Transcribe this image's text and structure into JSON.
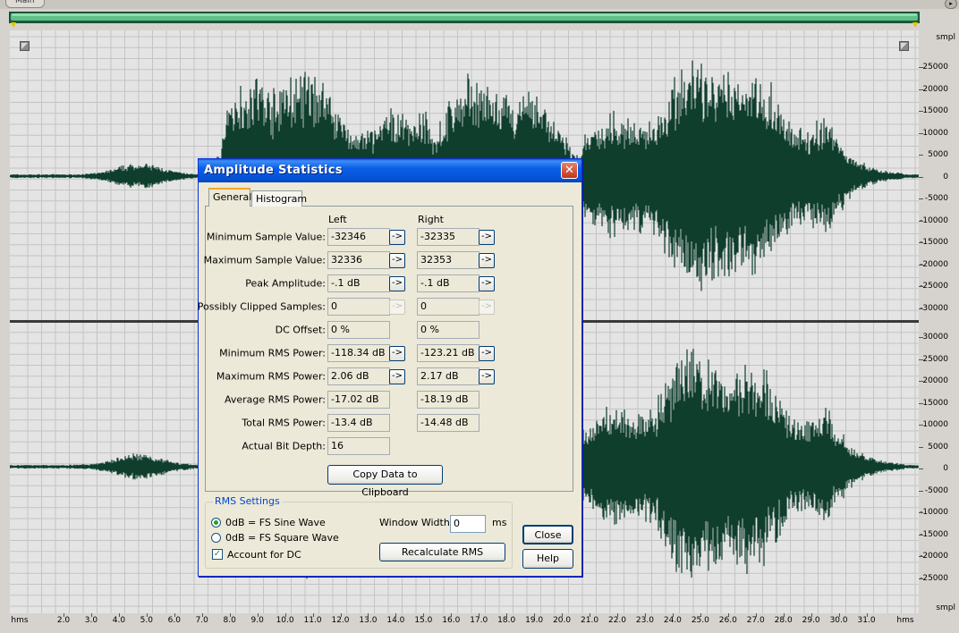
{
  "window": {
    "tab_label": "Main",
    "corner_button": "▸"
  },
  "colors": {
    "waveform": "#0f3e2d",
    "grid": "#c4c4c4",
    "background": "#e4e4e4",
    "divider": "#3a3a3a"
  },
  "vertical_ruler": {
    "unit": "smpl",
    "upper_labels": [
      "25000",
      "20000",
      "15000",
      "10000",
      "5000",
      "0",
      "-5000",
      "-10000",
      "-15000",
      "-20000",
      "-25000",
      "-30000"
    ],
    "lower_labels": [
      "30000",
      "25000",
      "20000",
      "15000",
      "10000",
      "5000",
      "0",
      "-5000",
      "-10000",
      "-15000",
      "-20000",
      "-25000"
    ]
  },
  "time_ruler": {
    "unit": "hms",
    "labels": [
      "2.0",
      "3.0",
      "4.0",
      "5.0",
      "6.0",
      "7.0",
      "8.0",
      "9.0",
      "10.0",
      "11.0",
      "12.0",
      "13.0",
      "14.0",
      "15.0",
      "16.0",
      "17.0",
      "18.0",
      "19.0",
      "20.0",
      "21.0",
      "22.0",
      "23.0",
      "24.0",
      "25.0",
      "26.0",
      "27.0",
      "28.0",
      "29.0",
      "30.0",
      "31.0"
    ]
  },
  "dialog": {
    "title": "Amplitude Statistics",
    "close_glyph": "✕",
    "tabs": [
      "General",
      "Histogram"
    ],
    "columns": {
      "left": "Left",
      "right": "Right"
    },
    "arrow_glyph": "->",
    "rows": [
      {
        "label": "Minimum Sample Value:",
        "left": "-32346",
        "right": "-32335",
        "arrow": "enabled"
      },
      {
        "label": "Maximum Sample Value:",
        "left": "32336",
        "right": "32353",
        "arrow": "enabled"
      },
      {
        "label": "Peak Amplitude:",
        "left": "-.1 dB",
        "right": "-.1 dB",
        "arrow": "enabled"
      },
      {
        "label": "Possibly Clipped Samples:",
        "left": "0",
        "right": "0",
        "arrow": "disabled"
      },
      {
        "label": "DC Offset:",
        "left": "0 %",
        "right": "0 %",
        "arrow": "none"
      },
      {
        "label": "Minimum RMS Power:",
        "left": "-118.34 dB",
        "right": "-123.21 dB",
        "arrow": "enabled"
      },
      {
        "label": "Maximum RMS Power:",
        "left": "2.06 dB",
        "right": "2.17 dB",
        "arrow": "enabled"
      },
      {
        "label": "Average RMS Power:",
        "left": "-17.02 dB",
        "right": "-18.19 dB",
        "arrow": "none"
      },
      {
        "label": "Total RMS Power:",
        "left": "-13.4 dB",
        "right": "-14.48 dB",
        "arrow": "none"
      },
      {
        "label": "Actual Bit Depth:",
        "left": "16",
        "right": null,
        "arrow": "none"
      }
    ],
    "copy_button": "Copy Data to Clipboard",
    "rms_settings": {
      "legend": "RMS Settings",
      "options": [
        "0dB = FS Sine Wave",
        "0dB = FS Square Wave"
      ],
      "selected_index": 0,
      "account_for_dc_label": "Account for DC",
      "account_for_dc_checked": true,
      "window_width_label": "Window Width:",
      "window_width_value": "0",
      "window_width_unit": "ms",
      "recalculate_button": "Recalculate RMS"
    },
    "close_button": "Close",
    "help_button": "Help"
  }
}
